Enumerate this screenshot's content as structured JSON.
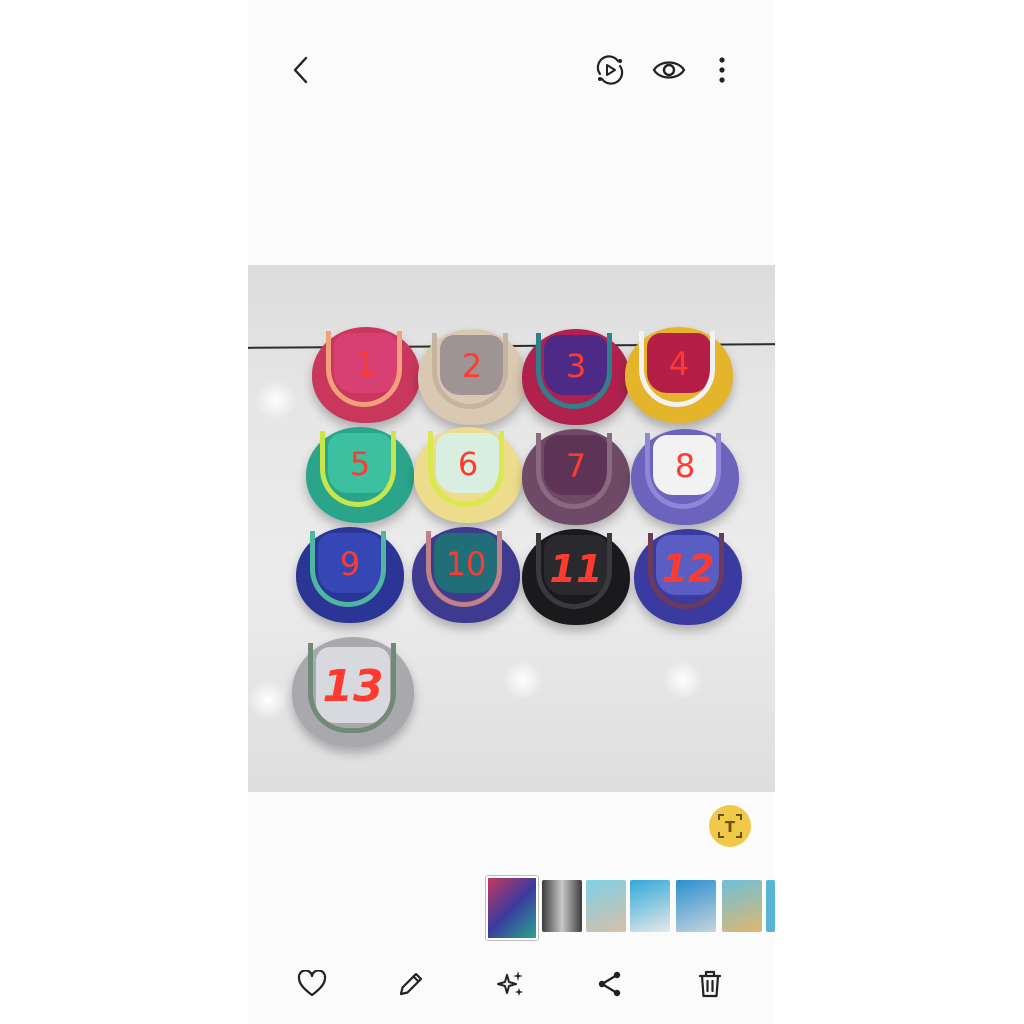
{
  "toolbar": {
    "back_icon": "back-arrow-icon",
    "motion_icon": "motion-photo-icon",
    "view_icon": "eye-icon",
    "more_icon": "more-vertical-icon"
  },
  "photo": {
    "caps": [
      {
        "label": "1"
      },
      {
        "label": "2"
      },
      {
        "label": "3"
      },
      {
        "label": "4"
      },
      {
        "label": "5"
      },
      {
        "label": "6"
      },
      {
        "label": "7"
      },
      {
        "label": "8"
      },
      {
        "label": "9"
      },
      {
        "label": "10"
      },
      {
        "label": "11"
      },
      {
        "label": "12"
      },
      {
        "label": "13"
      }
    ]
  },
  "lens": {
    "icon": "text-extract-icon",
    "glyph": "T"
  },
  "actions": {
    "favorite_icon": "heart-icon",
    "edit_icon": "pencil-icon",
    "enhance_icon": "sparkle-icon",
    "share_icon": "share-icon",
    "delete_icon": "trash-icon"
  },
  "colors": {
    "accent": "#f0c94a",
    "number_red": "#ff3b30"
  }
}
